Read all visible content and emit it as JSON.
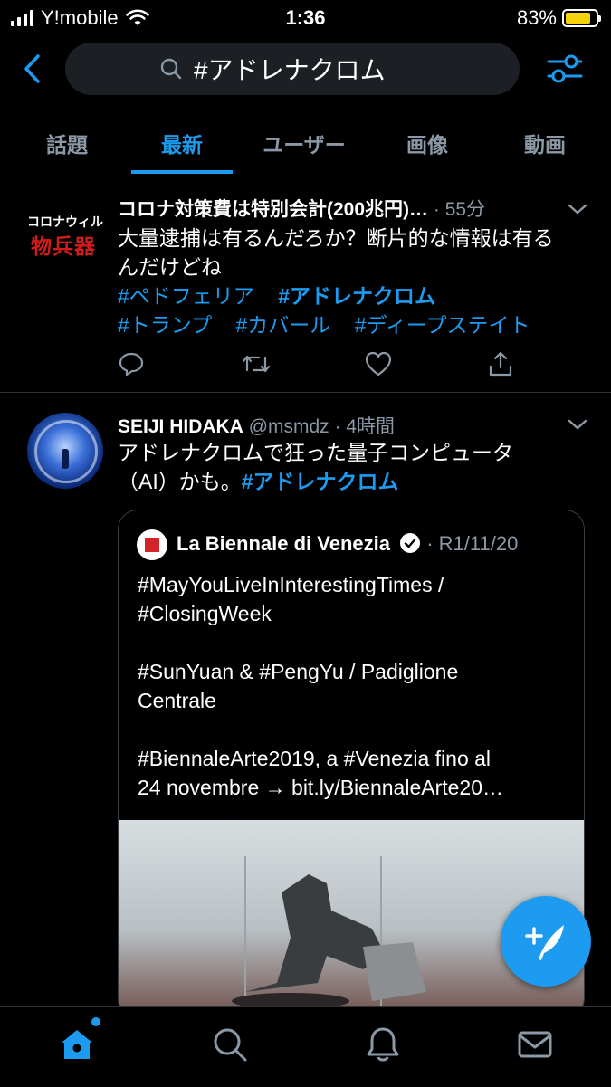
{
  "status": {
    "carrier": "Y!mobile",
    "time": "1:36",
    "battery_pct": "83%",
    "battery_level": 0.83
  },
  "search": {
    "query": "#アドレナクロム"
  },
  "tabs": [
    {
      "label": "話題",
      "active": false
    },
    {
      "label": "最新",
      "active": true
    },
    {
      "label": "ユーザー",
      "active": false
    },
    {
      "label": "画像",
      "active": false
    },
    {
      "label": "動画",
      "active": false
    }
  ],
  "tweet1": {
    "avatar_line1": "コロナウィル",
    "avatar_line2": "物兵器",
    "name": "コロナ対策費は特別会計(200兆円)…",
    "time": "· 55分",
    "text_line1": "大量逮捕は有るんだろか？断片的な情報は有る",
    "text_line2": "んだけどね",
    "hashtags_row1": [
      "#ペドフェリア",
      "#アドレナクロム"
    ],
    "hashtags_row2": [
      "#トランプ",
      "#カバール",
      "#ディープステイト"
    ]
  },
  "tweet2": {
    "name": "SEIJI HIDAKA",
    "handle": "@msmdz",
    "time": "· 4時間",
    "text_line1": "アドレナクロムで狂った量子コンピュータ",
    "text_line2_prefix": "（AI）かも。",
    "text_line2_hashtag": "#アドレナクロム",
    "quote": {
      "name": "La Biennale di Venezia",
      "date": "· R1/11/20",
      "text": "#MayYouLiveInInterestingTimes /\n#ClosingWeek\n\n#SunYuan & #PengYu / Padiglione\nCentrale\n\n#BiennaleArte2019, a #Venezia fino al\n24 novembre → bit.ly/BiennaleArte20…"
    }
  },
  "colors": {
    "accent": "#1d9bf0",
    "background": "#000000",
    "muted": "#8b98a5",
    "divider": "#2f3336"
  },
  "icons": [
    "back-arrow-icon",
    "search-icon",
    "filter-sliders-icon",
    "reply-icon",
    "retweet-icon",
    "like-icon",
    "share-icon",
    "chevron-down-icon",
    "verified-badge-icon",
    "compose-icon",
    "home-icon",
    "search-nav-icon",
    "notifications-icon",
    "messages-icon"
  ]
}
